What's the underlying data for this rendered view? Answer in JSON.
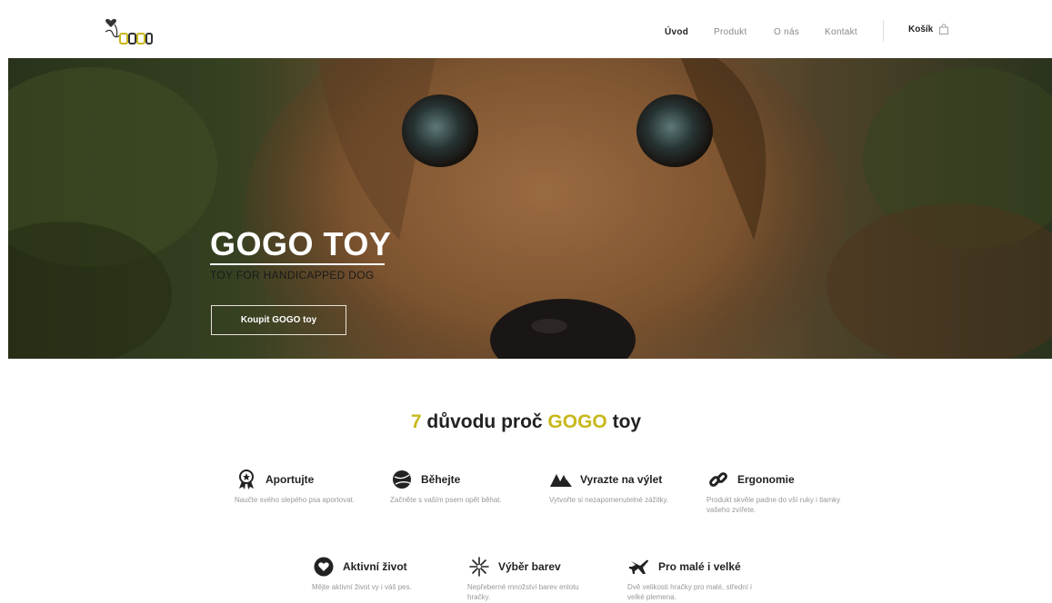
{
  "header": {
    "nav": [
      {
        "label": "Úvod",
        "active": true
      },
      {
        "label": "Produkt",
        "active": false
      },
      {
        "label": "O nás",
        "active": false
      },
      {
        "label": "Kontakt",
        "active": false
      }
    ],
    "cart_label": "Košík"
  },
  "hero": {
    "title": "GOGO TOY",
    "subtitle": "TOY FOR HANDICAPPED DOG",
    "button": "Koupit GOGO toy"
  },
  "reasons": {
    "num": "7",
    "part1": " důvodu proč ",
    "brand": "GOGO",
    "part2": " toy",
    "items": [
      {
        "title": "Aportujte",
        "desc": "Naučte svého slepého psa aportovat.",
        "icon": "award-icon"
      },
      {
        "title": "Běhejte",
        "desc": "Začněte s vaším psem opět běhat.",
        "icon": "ball-icon"
      },
      {
        "title": "Vyrazte na výlet",
        "desc": "Vytvořte si nezapomenutelné zážitky.",
        "icon": "mountains-icon"
      },
      {
        "title": "Ergonomie",
        "desc": "Produkt skvěle padne do vší ruky i tlamky vašeho zvířete.",
        "icon": "link-icon"
      },
      {
        "title": "Aktivní život",
        "desc": "Mějte aktivní život vy i váš pes.",
        "icon": "heart-icon"
      },
      {
        "title": "Výběr barev",
        "desc": "Nepřeberné množství barev enlotu hračky.",
        "icon": "sparkle-icon"
      },
      {
        "title": "Pro malé i velké",
        "desc": "Dvě velikosti hračky pro malé, střední i velké plemena.",
        "icon": "airplane-icon"
      }
    ]
  },
  "colors": {
    "accent": "#c8b81c",
    "text": "#222222",
    "muted": "#999999"
  }
}
